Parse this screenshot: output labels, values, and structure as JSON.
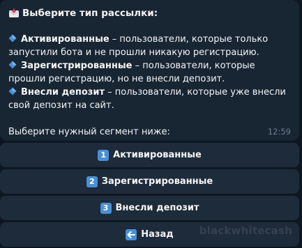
{
  "message": {
    "title": "Выберите тип рассылки:",
    "items": [
      {
        "bold": "Активированные",
        "text": " – пользователи, которые только запустили бота и не прошли никакую регистрацию."
      },
      {
        "bold": "Зарегистрированные",
        "text": " – пользователи, которые прошли регистрацию, но не внесли депозит."
      },
      {
        "bold": "Внесли депозит",
        "text": " – пользователи, которые уже внесли свой депозит на сайт."
      }
    ],
    "prompt": "Выберите нужный сегмент ниже:",
    "time": "12:59"
  },
  "keyboard": {
    "buttons": [
      {
        "icon": "1",
        "label": "Активированные"
      },
      {
        "icon": "2",
        "label": "Зарегистрированные"
      },
      {
        "icon": "3",
        "label": "Внесли депозит"
      },
      {
        "icon": "back-arrow-icon",
        "label": "Назад"
      }
    ]
  },
  "watermark": "blackwhitecash",
  "colors": {
    "background": "#0e1621",
    "bubble": "#182533",
    "button": "#1d2b3a",
    "accent": "#4a8fd6",
    "timestamp": "#6d7f8f"
  }
}
